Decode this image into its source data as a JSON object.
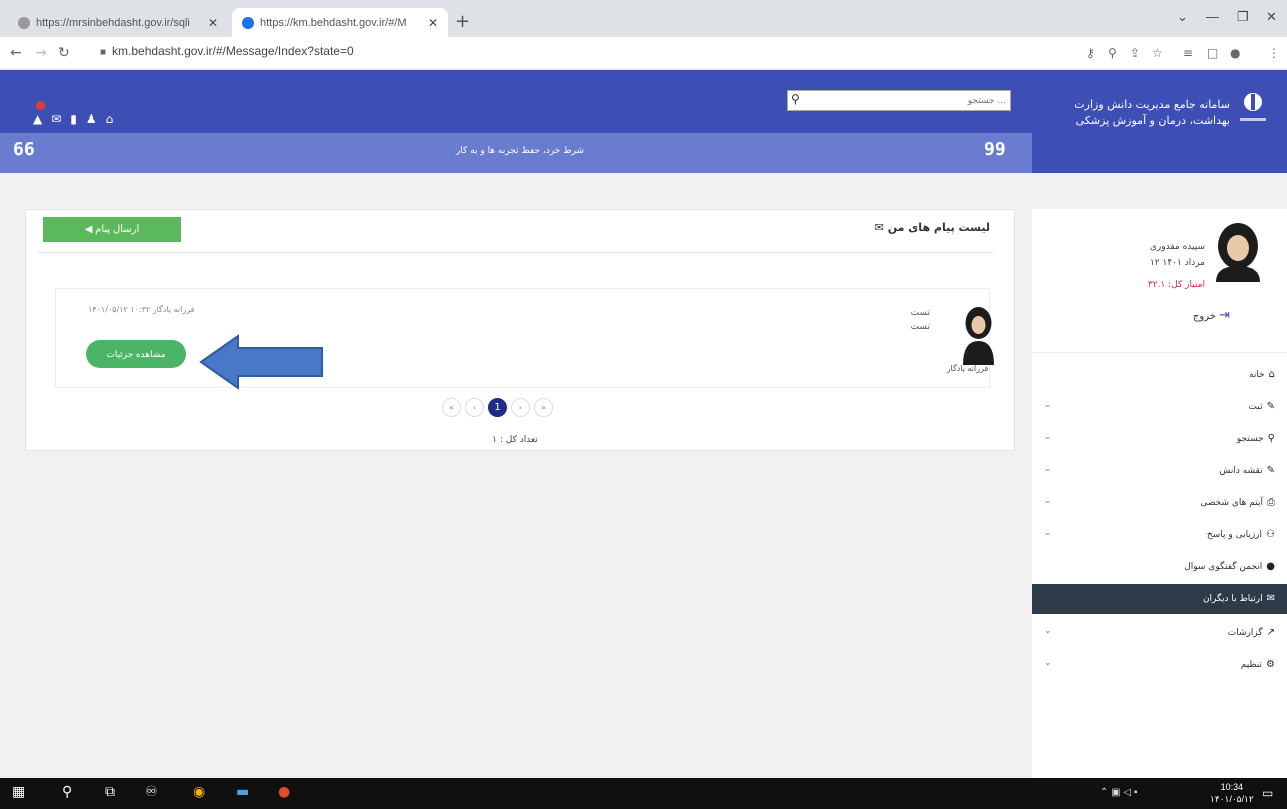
{
  "browser": {
    "tabs": [
      {
        "title": "https://mrsinbehdasht.gov.ir/sqli",
        "active": false
      },
      {
        "title": "https://km.behdasht.gov.ir/#/M",
        "active": true
      }
    ],
    "new_tab": "+",
    "address": "km.behdasht.gov.ir/#/Message/Index?state=0",
    "window_controls": {
      "minimize": "—",
      "restore": "❐",
      "close": "✕"
    },
    "chevron": "⌄"
  },
  "header": {
    "site_title_line1": "سامانه جامع مدیریت دانش   وزارت",
    "site_title_line2": "بهداشت، درمان و آموزش پزشکی",
    "search_placeholder": "جستجو ...",
    "slogan": "شرط خرد، حفظ تجربه ها و به کار",
    "number_left": "66",
    "number_right": "99",
    "accent_color": "#3d4fb5"
  },
  "main": {
    "send_button": "◀ ارسال پیام",
    "list_title": "✉ لیست پیام های من",
    "message": {
      "sender_name": "فرزانه یادگار",
      "line1": "تست",
      "line2": "تست",
      "meta": "۱۴۰۱/۰۵/۱۲ ۱۰:۳۲ فرزانه یادگار",
      "detail_button": "مشاهده جزئیات"
    },
    "pagination": [
      "«",
      "‹",
      "1",
      "›",
      "»"
    ],
    "total_label": "تعداد کل : ۱"
  },
  "sidebar": {
    "user_name": "سپیده مقدوری",
    "user_date": "۱۲ مرداد ۱۴۰۱",
    "credit": "امتیاز کل: ۳۲.۱",
    "logout": "خروج",
    "items": [
      {
        "label": "خانه",
        "icon": "⌂",
        "has_children": false,
        "active": false
      },
      {
        "label": "ثبت",
        "icon": "✎",
        "has_children": true,
        "active": false
      },
      {
        "label": "جستجو",
        "icon": "⚲",
        "has_children": true,
        "active": false
      },
      {
        "label": "نقشه دانش",
        "icon": "✎",
        "has_children": true,
        "active": false
      },
      {
        "label": "آیتم های شخصی",
        "icon": "⎙",
        "has_children": true,
        "active": false
      },
      {
        "label": "ارزیابی و پاسخ",
        "icon": "⚇",
        "has_children": true,
        "active": false
      },
      {
        "label": "انجمن گفتگوی سوال",
        "icon": "●",
        "has_children": false,
        "active": false
      },
      {
        "label": "ارتباط با دیگران",
        "icon": "✉",
        "has_children": false,
        "active": true
      },
      {
        "label": "گزارشات",
        "icon": "↗",
        "has_children": true,
        "active": false
      },
      {
        "label": "تنظیم",
        "icon": "⚙",
        "has_children": true,
        "active": false
      }
    ]
  },
  "taskbar": {
    "time": "10:34",
    "date": "۱۴۰۱/۰۵/۱۲"
  }
}
